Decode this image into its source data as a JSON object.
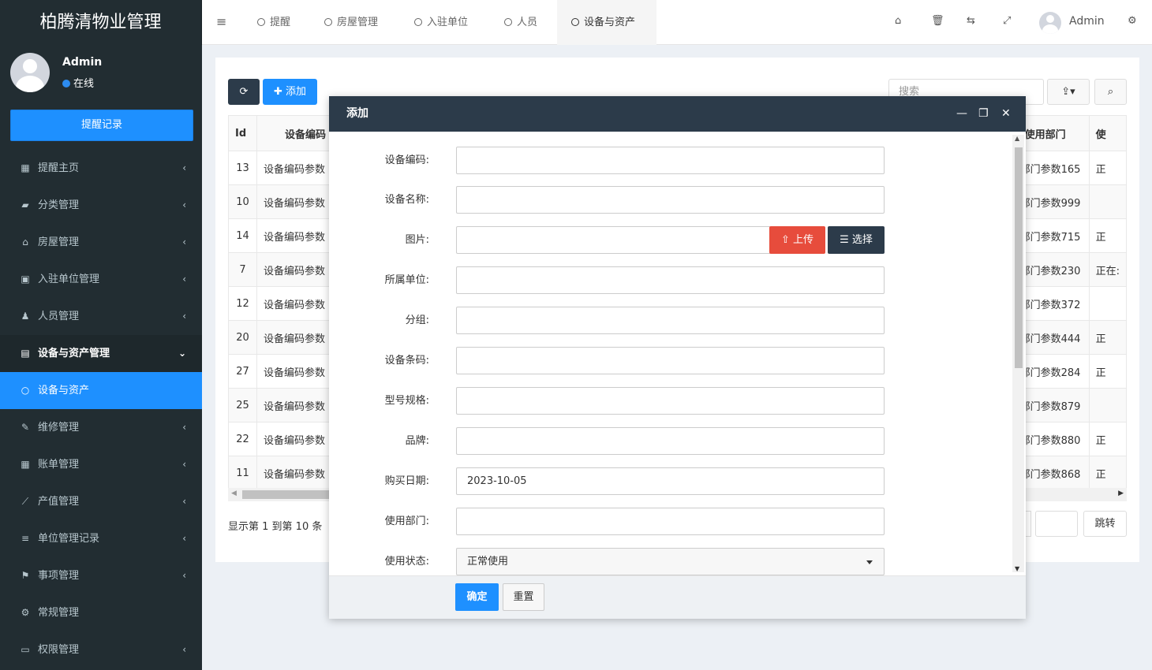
{
  "app": {
    "title": "柏腾清物业管理"
  },
  "user": {
    "name": "Admin",
    "status": "在线",
    "remind_button": "提醒记录"
  },
  "sidebar": {
    "items": [
      {
        "icon": "calendar-icon",
        "glyph": "▦",
        "label": "提醒主页",
        "chevron": "‹"
      },
      {
        "icon": "book-icon",
        "glyph": "▰",
        "label": "分类管理",
        "chevron": "‹"
      },
      {
        "icon": "home-icon",
        "glyph": "⌂",
        "label": "房屋管理",
        "chevron": "‹"
      },
      {
        "icon": "briefcase-icon",
        "glyph": "▣",
        "label": "入驻单位管理",
        "chevron": "‹"
      },
      {
        "icon": "users-icon",
        "glyph": "♟",
        "label": "人员管理",
        "chevron": "‹"
      },
      {
        "icon": "list-alt-icon",
        "glyph": "▤",
        "label": "设备与资产管理",
        "chevron": "⌄"
      },
      {
        "icon": "circle-o-icon",
        "glyph": "○",
        "label": "设备与资产",
        "chevron": ""
      },
      {
        "icon": "wrench-icon",
        "glyph": "✎",
        "label": "维修管理",
        "chevron": "‹"
      },
      {
        "icon": "calculator-icon",
        "glyph": "▦",
        "label": "账单管理",
        "chevron": "‹"
      },
      {
        "icon": "line-chart-icon",
        "glyph": "⟋",
        "label": "产值管理",
        "chevron": "‹"
      },
      {
        "icon": "bars-icon",
        "glyph": "≡",
        "label": "单位管理记录",
        "chevron": "‹"
      },
      {
        "icon": "flag-icon",
        "glyph": "⚑",
        "label": "事项管理",
        "chevron": "‹"
      },
      {
        "icon": "cogs-icon",
        "glyph": "⚙",
        "label": "常规管理",
        "chevron": ""
      },
      {
        "icon": "desktop-icon",
        "glyph": "▭",
        "label": "权限管理",
        "chevron": "‹"
      }
    ]
  },
  "topbar": {
    "tabs": [
      {
        "label": "提醒"
      },
      {
        "label": "房屋管理"
      },
      {
        "label": "入驻单位"
      },
      {
        "label": "人员"
      },
      {
        "label": "设备与资产"
      }
    ],
    "icons": {
      "home": "⌂",
      "trash": "🗑",
      "translate": "⇆",
      "fullscreen": "⤢",
      "settings": "⚙"
    },
    "user": "Admin"
  },
  "toolbar": {
    "refresh_glyph": "⟳",
    "add_label": "✚ 添加",
    "search_placeholder": "搜索",
    "export_glyph": "⇪▾",
    "search_glyph": "⌕"
  },
  "table": {
    "headers": [
      "Id",
      "设备编码",
      "使用部门",
      "使"
    ],
    "rows": [
      {
        "id": "13",
        "code": "设备编码参数",
        "dept": "部门参数165",
        "status": "正"
      },
      {
        "id": "10",
        "code": "设备编码参数",
        "dept": "部门参数999",
        "status": ""
      },
      {
        "id": "14",
        "code": "设备编码参数",
        "dept": "部门参数715",
        "status": "正"
      },
      {
        "id": "7",
        "code": "设备编码参数",
        "dept": "部门参数230",
        "status": "正在:"
      },
      {
        "id": "12",
        "code": "设备编码参数",
        "dept": "部门参数372",
        "status": ""
      },
      {
        "id": "20",
        "code": "设备编码参数",
        "dept": "部门参数444",
        "status": "正"
      },
      {
        "id": "27",
        "code": "设备编码参数",
        "dept": "部门参数284",
        "status": "正"
      },
      {
        "id": "25",
        "code": "设备编码参数",
        "dept": "部门参数879",
        "status": ""
      },
      {
        "id": "22",
        "code": "设备编码参数",
        "dept": "部门参数880",
        "status": "正"
      },
      {
        "id": "11",
        "code": "设备编码参数",
        "dept": "部门参数868",
        "status": "正"
      }
    ]
  },
  "pager": {
    "info": "显示第 1 到第 10 条",
    "jump_label": "跳转"
  },
  "modal": {
    "title": "添加",
    "controls": {
      "minimize": "—",
      "maximize": "❐",
      "close": "✕"
    },
    "fields": [
      {
        "label": "设备编码:",
        "value": ""
      },
      {
        "label": "设备名称:",
        "value": ""
      },
      {
        "label": "图片:",
        "value": ""
      },
      {
        "label": "所属单位:",
        "value": ""
      },
      {
        "label": "分组:",
        "value": ""
      },
      {
        "label": "设备条码:",
        "value": ""
      },
      {
        "label": "型号规格:",
        "value": ""
      },
      {
        "label": "品牌:",
        "value": ""
      },
      {
        "label": "购买日期:",
        "value": "2023-10-05"
      },
      {
        "label": "使用部门:",
        "value": ""
      },
      {
        "label": "使用状态:",
        "value": "正常使用"
      }
    ],
    "upload_label": "⇧ 上传",
    "choose_label": "☰ 选择",
    "confirm_label": "确定",
    "reset_label": "重置"
  }
}
